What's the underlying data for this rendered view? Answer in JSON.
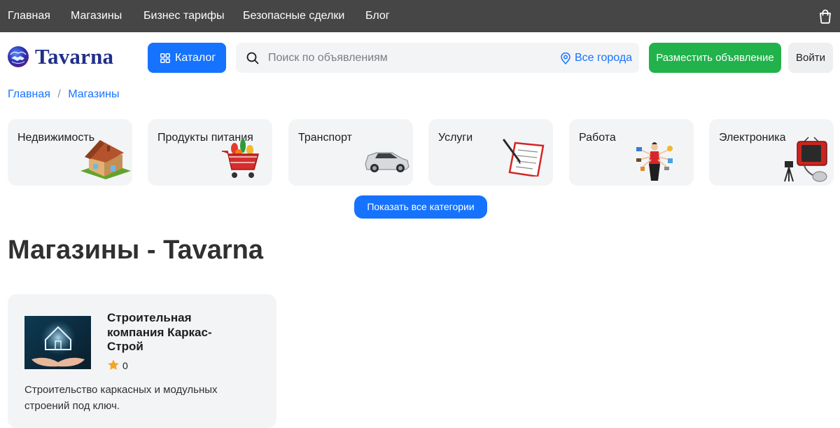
{
  "nav": {
    "items": [
      {
        "label": "Главная"
      },
      {
        "label": "Магазины"
      },
      {
        "label": "Бизнес тарифы"
      },
      {
        "label": "Безопасные сделки"
      },
      {
        "label": "Блог"
      }
    ],
    "cart_icon": "shopping-bag-icon"
  },
  "header": {
    "logo_text": "Tavarna",
    "catalog_label": "Каталог",
    "search_placeholder": "Поиск по объявлениям",
    "search_value": "",
    "city_label": "Все города",
    "post_label": "Разместить объявление",
    "login_label": "Войти"
  },
  "breadcrumb": {
    "items": [
      {
        "label": "Главная"
      },
      {
        "label": "Магазины"
      }
    ],
    "separator": "/"
  },
  "categories": [
    {
      "label": "Недвижимость",
      "icon": "house-icon"
    },
    {
      "label": "Продукты питания",
      "icon": "grocery-cart-icon"
    },
    {
      "label": "Транспорт",
      "icon": "car-icon"
    },
    {
      "label": "Услуги",
      "icon": "clipboard-icon"
    },
    {
      "label": "Работа",
      "icon": "multitask-worker-icon"
    },
    {
      "label": "Электроника",
      "icon": "tv-icon"
    }
  ],
  "show_all_label": "Показать все категории",
  "page_title": "Магазины - Tavarna",
  "shops": [
    {
      "name": "Строительная компания Каркас-Строй",
      "rating": "0",
      "description": "Строительство каркасных и модульных строений под ключ."
    }
  ],
  "colors": {
    "accent": "#1573ff",
    "post_button": "#22b24c",
    "topbar": "#464646",
    "card_bg": "#f3f4f6",
    "star": "#f5a623"
  }
}
